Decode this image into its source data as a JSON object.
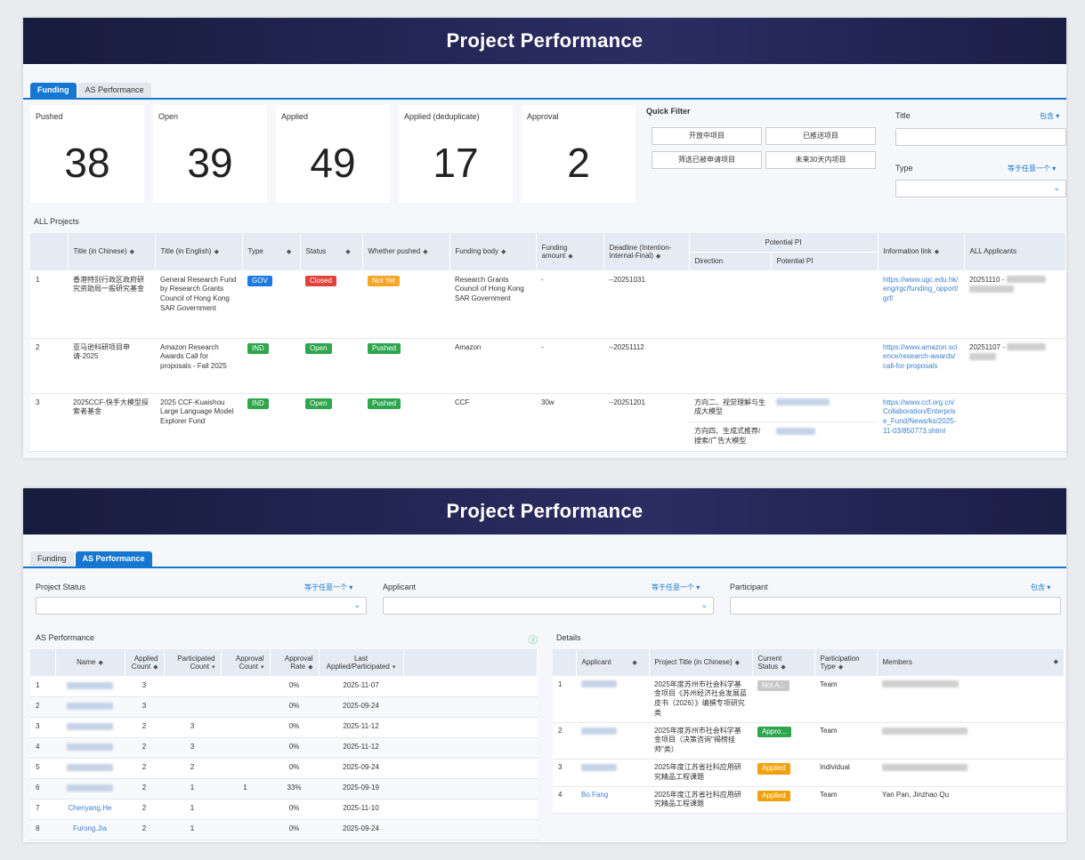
{
  "funding_view": {
    "title": "Project Performance",
    "tabs": [
      {
        "label": "Funding"
      },
      {
        "label": "AS Performance"
      }
    ],
    "stats": [
      {
        "label": "Pushed",
        "value": "38"
      },
      {
        "label": "Open",
        "value": "39"
      },
      {
        "label": "Applied",
        "value": "49"
      },
      {
        "label": "Applied (deduplicate)",
        "value": "17"
      },
      {
        "label": "Approval",
        "value": "2"
      }
    ],
    "quick_filter": {
      "title": "Quick Filter",
      "buttons": [
        "开放中项目",
        "已推送项目",
        "筛选已被申请项目",
        "未来30天内项目"
      ]
    },
    "filters": {
      "title_label": "Title",
      "title_op": "包含 ▾",
      "type_label": "Type",
      "type_op": "等于任意一个 ▾"
    },
    "section_label": "ALL Projects",
    "table": {
      "headers": [
        "Title (in Chinese)",
        "Title (in English)",
        "Type",
        "Status",
        "Whether pushed",
        "Funding body",
        "Funding amount",
        "Deadline (Intention-Internal-Final)",
        "Potential PI",
        "Direction",
        "Potential PI",
        "Information link",
        "ALL Applicants"
      ],
      "rows": [
        {
          "idx": "1",
          "cn": "香港特别行政区政府研究资助局一般研究基金",
          "en": "General Research Fund by Research Grants Council of Hong Kong SAR Government",
          "type": "GOV",
          "status": "Closed",
          "pushed": "Not Yet",
          "body": "Research Grants Council of Hong Kong SAR Government",
          "amount": "-",
          "deadline": "--20251031",
          "direction": "",
          "link": "https://www.ugc.edu.hk/eng/rgc/funding_opport/grf/",
          "applicants": "20251110 -"
        },
        {
          "idx": "2",
          "cn": "亚马逊科研项目申请-2025",
          "en": "Amazon Research Awards Call for proposals - Fall 2025",
          "type": "IND",
          "status": "Open",
          "pushed": "Pushed",
          "body": "Amazon",
          "amount": "-",
          "deadline": "--20251112",
          "direction": "",
          "link": "https://www.amazon.science/research-awards/call-for-proposals",
          "applicants": "20251107 -"
        },
        {
          "idx": "3",
          "cn": "2025CCF-快手大模型探索者基金",
          "en": "2025 CCF-Kuaishou Large Language Model Explorer Fund",
          "type": "IND",
          "status": "Open",
          "pushed": "Pushed",
          "body": "CCF",
          "amount": "30w",
          "deadline": "--20251201",
          "direction": "方向二、视觉理解与生成大模型",
          "direction2": "方向四、生成式推荐/搜索/广告大模型",
          "link": "https://www.ccf.org.cn/Collaboration/Enterprise_Fund/News/ks/2025-11-03/850773.shtml",
          "applicants": ""
        }
      ]
    }
  },
  "as_view": {
    "title": "Project Performance",
    "tabs": [
      {
        "label": "Funding"
      },
      {
        "label": "AS Performance"
      }
    ],
    "filters": [
      {
        "label": "Project Status",
        "op": "等于任意一个 ▾"
      },
      {
        "label": "Applicant",
        "op": "等于任意一个 ▾"
      },
      {
        "label": "Participant",
        "op": "包含 ▾"
      }
    ],
    "left_label": "AS Performance",
    "right_label": "Details",
    "perf_table": {
      "headers": [
        "Name",
        "Applied Count",
        "Participated Count",
        "Approval Count",
        "Approval Rate",
        "Last Applied/Participated"
      ],
      "rows": [
        {
          "idx": "1",
          "name": "",
          "applied": "3",
          "participated": "",
          "approval": "",
          "rate": "0%",
          "last": "2025-11-07"
        },
        {
          "idx": "2",
          "name": "",
          "applied": "3",
          "participated": "",
          "approval": "",
          "rate": "0%",
          "last": "2025-09-24"
        },
        {
          "idx": "3",
          "name": "",
          "applied": "2",
          "participated": "3",
          "approval": "",
          "rate": "0%",
          "last": "2025-11-12"
        },
        {
          "idx": "4",
          "name": "",
          "applied": "2",
          "participated": "3",
          "approval": "",
          "rate": "0%",
          "last": "2025-11-12"
        },
        {
          "idx": "5",
          "name": "",
          "applied": "2",
          "participated": "2",
          "approval": "",
          "rate": "0%",
          "last": "2025-09-24"
        },
        {
          "idx": "6",
          "name": "",
          "applied": "2",
          "participated": "1",
          "approval": "1",
          "rate": "33%",
          "last": "2025-09-19"
        },
        {
          "idx": "7",
          "name": "Chenyang.He",
          "applied": "2",
          "participated": "1",
          "approval": "",
          "rate": "0%",
          "last": "2025-11-10"
        },
        {
          "idx": "8",
          "name": "Furong.Jia",
          "applied": "2",
          "participated": "1",
          "approval": "",
          "rate": "0%",
          "last": "2025-09-24"
        }
      ]
    },
    "detail_table": {
      "headers": [
        "Applicant",
        "Project Title (in Chinese)",
        "Current Status",
        "Participation Type",
        "Members"
      ],
      "rows": [
        {
          "idx": "1",
          "applicant": "",
          "title": "2025年度苏州市社会科学基金项目《苏州经济社会发展蓝皮书（2026）》编撰专项研究类",
          "status": "Not A...",
          "status_kind": "nota",
          "ptype": "Team",
          "members": ""
        },
        {
          "idx": "2",
          "applicant": "",
          "title": "2025年度苏州市社会科学基金项目（决策咨询\"揭榜挂帅\"类）",
          "status": "Appro...",
          "status_kind": "appro",
          "ptype": "Team",
          "members": ""
        },
        {
          "idx": "3",
          "applicant": "",
          "title": "2025年度江苏省社科应用研究精品工程课题",
          "status": "Applied",
          "status_kind": "applied",
          "ptype": "Individual",
          "members": ""
        },
        {
          "idx": "4",
          "applicant": "Bo.Fang",
          "title": "2025年度江苏省社科应用研究精品工程课题",
          "status": "Applied",
          "status_kind": "applied",
          "ptype": "Team",
          "members": "Yan Pan, Jinzhao Qu"
        }
      ]
    }
  }
}
